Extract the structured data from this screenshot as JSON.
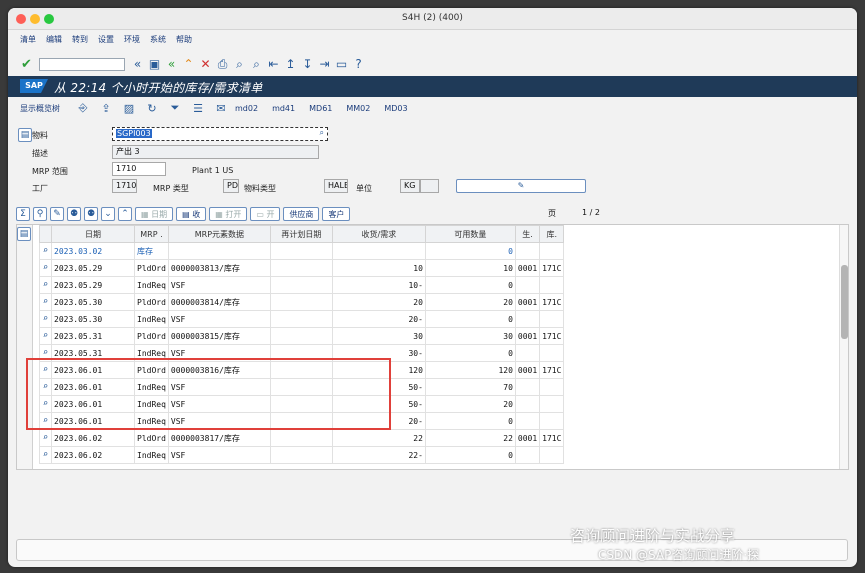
{
  "window": {
    "title": "S4H (2) (400)"
  },
  "menu": [
    "清单",
    "编辑",
    "转到",
    "设置",
    "环境",
    "系统",
    "帮助"
  ],
  "app": {
    "title": "从 22:14 个小时开始的库存/需求清单",
    "logo": "SAP"
  },
  "app_toolbar": {
    "overview": "显示概览树",
    "links": [
      "md02",
      "md41",
      "MD61",
      "MM02",
      "MD03"
    ]
  },
  "form": {
    "material_label": "物料",
    "material_value": "SGPI003",
    "desc_label": "描述",
    "desc_value": "产出 3",
    "mrp_area_label": "MRP 范围",
    "mrp_area_value": "1710",
    "mrp_area_text": "Plant 1 US",
    "plant_label": "工厂",
    "plant_value": "1710",
    "mrp_type_label": "MRP 类型",
    "mrp_type_value": "PD",
    "material_type_label": "物料类型",
    "material_type_value": "HALB",
    "unit_label": "单位",
    "unit_value": "KG"
  },
  "grid_toolbar": {
    "date_btn": "日期",
    "receipt_btn": "收",
    "open_btn": "打开",
    "open2_btn": "开",
    "vendor_btn": "供应商",
    "customer_btn": "客户",
    "page_label": "页",
    "page_value": "1 / 2"
  },
  "table": {
    "headers": [
      "日期",
      "MRP .",
      "MRP元素数据",
      "再计划日期",
      "收货/需求",
      "可用数量",
      "生.",
      "库."
    ],
    "rows": [
      {
        "date": "2023.03.02",
        "mrp": "库存",
        "elem": "",
        "resched": "",
        "qty": "",
        "avail": "0",
        "prod": "",
        "stor": "",
        "link": true
      },
      {
        "date": "2023.05.29",
        "mrp": "PldOrd",
        "elem": "0000003813/库存",
        "resched": "",
        "qty": "10",
        "avail": "10",
        "prod": "0001",
        "stor": "171C"
      },
      {
        "date": "2023.05.29",
        "mrp": "IndReq",
        "elem": "VSF",
        "resched": "",
        "qty": "10-",
        "avail": "0",
        "prod": "",
        "stor": ""
      },
      {
        "date": "2023.05.30",
        "mrp": "PldOrd",
        "elem": "0000003814/库存",
        "resched": "",
        "qty": "20",
        "avail": "20",
        "prod": "0001",
        "stor": "171C"
      },
      {
        "date": "2023.05.30",
        "mrp": "IndReq",
        "elem": "VSF",
        "resched": "",
        "qty": "20-",
        "avail": "0",
        "prod": "",
        "stor": ""
      },
      {
        "date": "2023.05.31",
        "mrp": "PldOrd",
        "elem": "0000003815/库存",
        "resched": "",
        "qty": "30",
        "avail": "30",
        "prod": "0001",
        "stor": "171C"
      },
      {
        "date": "2023.05.31",
        "mrp": "IndReq",
        "elem": "VSF",
        "resched": "",
        "qty": "30-",
        "avail": "0",
        "prod": "",
        "stor": ""
      },
      {
        "date": "2023.06.01",
        "mrp": "PldOrd",
        "elem": "0000003816/库存",
        "resched": "",
        "qty": "120",
        "avail": "120",
        "prod": "0001",
        "stor": "171C"
      },
      {
        "date": "2023.06.01",
        "mrp": "IndReq",
        "elem": "VSF",
        "resched": "",
        "qty": "50-",
        "avail": "70",
        "prod": "",
        "stor": ""
      },
      {
        "date": "2023.06.01",
        "mrp": "IndReq",
        "elem": "VSF",
        "resched": "",
        "qty": "50-",
        "avail": "20",
        "prod": "",
        "stor": ""
      },
      {
        "date": "2023.06.01",
        "mrp": "IndReq",
        "elem": "VSF",
        "resched": "",
        "qty": "20-",
        "avail": "0",
        "prod": "",
        "stor": ""
      },
      {
        "date": "2023.06.02",
        "mrp": "PldOrd",
        "elem": "0000003817/库存",
        "resched": "",
        "qty": "22",
        "avail": "22",
        "prod": "0001",
        "stor": "171C"
      },
      {
        "date": "2023.06.02",
        "mrp": "IndReq",
        "elem": "VSF",
        "resched": "",
        "qty": "22-",
        "avail": "0",
        "prod": "",
        "stor": ""
      }
    ]
  },
  "watermark": {
    "line1": "咨询顾问进阶与实战分享",
    "line2": "CSDN @SAP咨询顾问进阶·探"
  },
  "colors": {
    "title_bar": "#1f3a58",
    "highlight": "#e0403a",
    "link": "#1a5fb4",
    "light_red": "#fe5f57",
    "light_yellow": "#febc2e",
    "light_green": "#28c840"
  }
}
